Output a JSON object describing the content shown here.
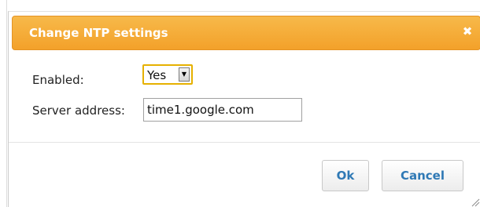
{
  "dialog": {
    "title": "Change NTP settings",
    "close_icon": "close-icon"
  },
  "form": {
    "enabled_label": "Enabled:",
    "enabled_value": "Yes",
    "server_label": "Server address:",
    "server_value": "time1.google.com"
  },
  "buttons": {
    "ok_label": "Ok",
    "cancel_label": "Cancel"
  },
  "colors": {
    "titlebar": "#f3a12a",
    "button_text": "#2f79b5",
    "focus_border": "#e6b100"
  }
}
